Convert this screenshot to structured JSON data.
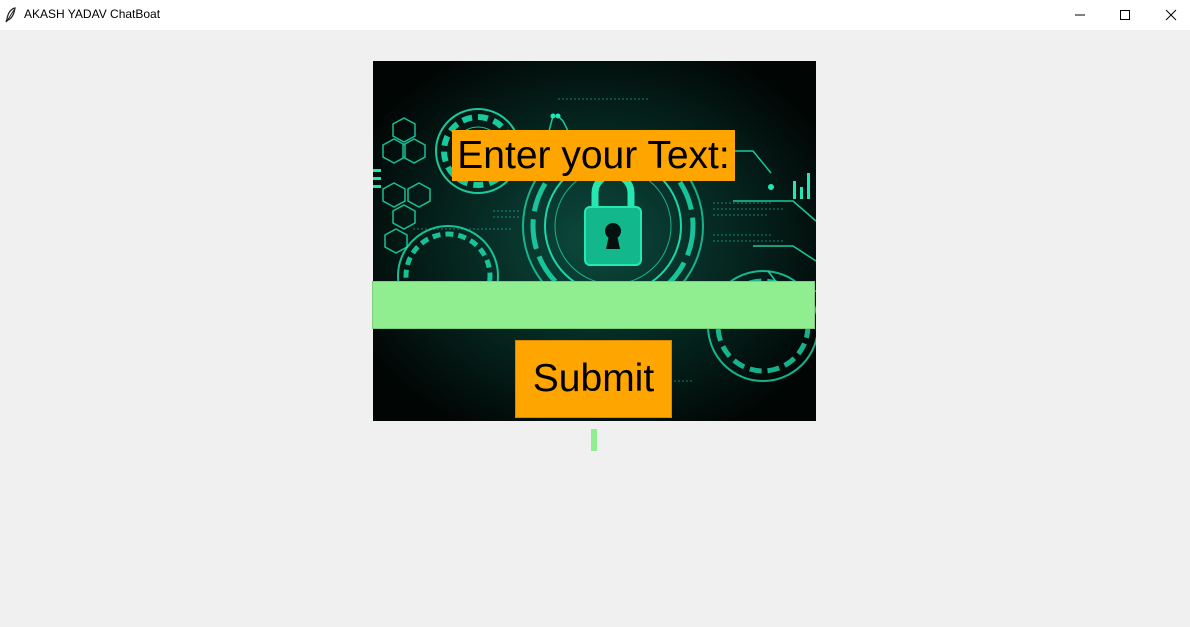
{
  "window": {
    "title": "AKASH YADAV ChatBoat",
    "controls": {
      "minimize_icon": "minimize-icon",
      "maximize_icon": "maximize-icon",
      "close_icon": "close-icon"
    }
  },
  "main": {
    "background_image": "cyber-security-padlock-image",
    "prompt_label": "Enter your Text:",
    "input": {
      "value": "",
      "placeholder": ""
    },
    "submit_label": "Submit",
    "output_text": ""
  },
  "colors": {
    "window_bg": "#f0f0f0",
    "label_bg": "#ffa500",
    "entry_bg": "#90ee90",
    "image_accent": "#1de9b6"
  }
}
